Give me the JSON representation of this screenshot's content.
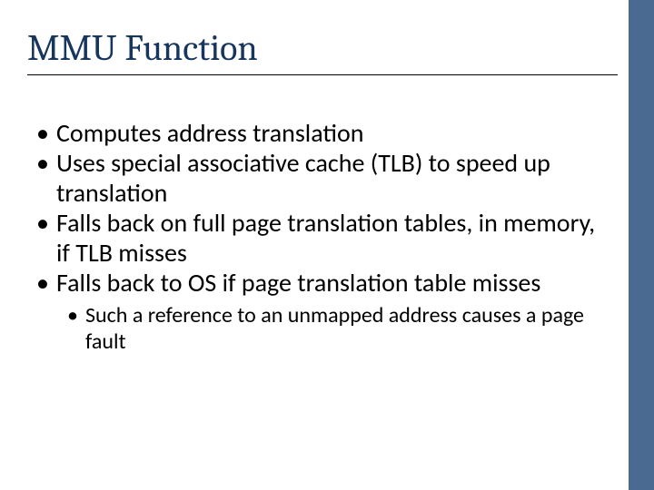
{
  "accent_color": "#4a6a92",
  "title_color": "#17365d",
  "slide": {
    "title": "MMU Function",
    "bullets": [
      "Computes address translation",
      "Uses special associative cache (TLB) to speed up translation",
      "Falls back on full page translation tables, in memory, if TLB misses",
      "Falls back to OS if page translation table misses"
    ],
    "sub_bullets": [
      "Such a reference to an unmapped address causes a page fault"
    ]
  }
}
